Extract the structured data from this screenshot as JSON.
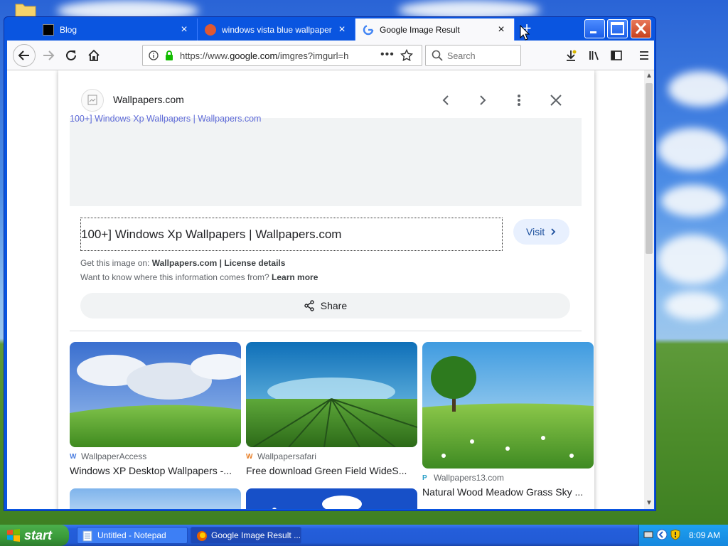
{
  "desktop": {
    "wallpaper": "windows-xp-bliss"
  },
  "browser": {
    "tabs": [
      {
        "label": "Blog",
        "active": false
      },
      {
        "label": "windows vista blue wallpaper at D",
        "active": false
      },
      {
        "label": "Google Image Result",
        "active": true
      }
    ],
    "url": {
      "prefix": "https://www.",
      "domain": "google.com",
      "rest": "/imgres?imgurl=h"
    },
    "search_placeholder": "Search"
  },
  "panel": {
    "site_name": "Wallpapers.com",
    "preview_caption": "100+] Windows Xp Wallpapers | Wallpapers.com",
    "title": "100+] Windows Xp Wallpapers | Wallpapers.com",
    "visit_label": "Visit",
    "get_image_prefix": "Get this image on:",
    "get_image_site": "Wallpapers.com",
    "separator": "|",
    "license_label": "License details",
    "info_prefix": "Want to know where this information comes from?",
    "learn_more": "Learn more",
    "share_label": "Share"
  },
  "related": [
    {
      "source": "WallpaperAccess",
      "caption": "Windows XP Desktop Wallpapers -..."
    },
    {
      "source": "Wallpapersafari",
      "caption": "Free download Green Field WideS..."
    },
    {
      "source": "Wallpapers13.com",
      "caption": "Natural Wood Meadow Grass Sky ..."
    }
  ],
  "taskbar": {
    "start_label": "start",
    "tasks": [
      {
        "label": "Untitled - Notepad",
        "active": false
      },
      {
        "label": "Google Image Result ...",
        "active": true
      }
    ],
    "clock": "8:09 AM"
  }
}
